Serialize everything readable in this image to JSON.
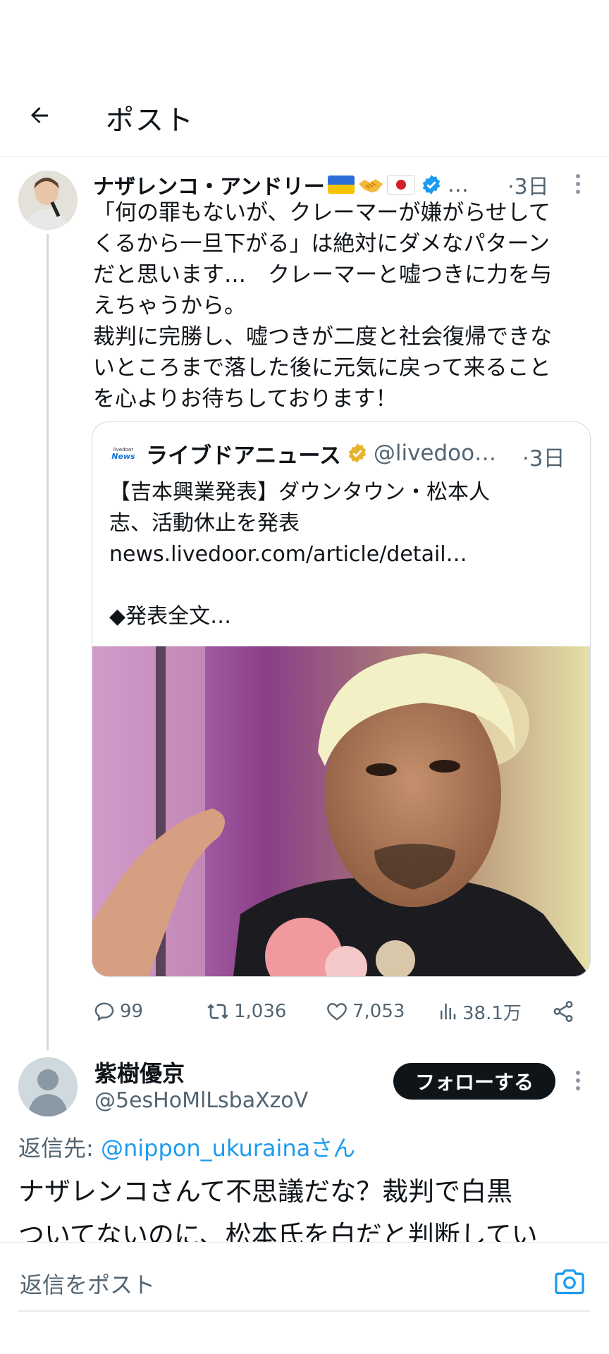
{
  "header": {
    "title": "ポスト"
  },
  "post": {
    "author_name": "ナザレンコ・アンドリー",
    "author_suffix": "…",
    "time": "·3日",
    "text": "「何の罪もないが、クレーマーが嫌がらせして\nくるから一旦下がる」は絶対にダメなパターン\nだと思います…　クレーマーと嘘つきに力を与\nえちゃうから。\n裁判に完勝し、嘘つきが二度と社会復帰できな\nいところまで落した後に元気に戻って来ること\nを心よりお待ちしております！",
    "quote": {
      "logo_small": "livedoor",
      "logo_news": "News",
      "name": "ライブドアニュース",
      "handle": "@livedoo…",
      "time": "·3日",
      "text": "【吉本興業発表】ダウンタウン・松本人\n志、活動休止を発表\nnews.livedoor.com/article/detail…\n\n◆発表全文…"
    },
    "actions": {
      "replies": "99",
      "reposts": "1,036",
      "likes": "7,053",
      "views": "38.1万"
    }
  },
  "reply": {
    "name": "紫樹優京",
    "handle": "@5esHoMlLsbaXzoV",
    "follow_label": "フォローする",
    "reply_to_prefix": "返信先: ",
    "reply_to_handle": "@nippon_ukuraina",
    "reply_to_suffix": "さん",
    "text": "ナザレンコさんて不思議だな？裁判で白黒\nついてないのに、松本氏を白だと判断してい"
  },
  "composer": {
    "placeholder": "返信をポスト"
  },
  "colors": {
    "accent": "#1d9bf0",
    "text": "#0f1419",
    "muted": "#536471",
    "gold_badge": "#e8b32c"
  }
}
